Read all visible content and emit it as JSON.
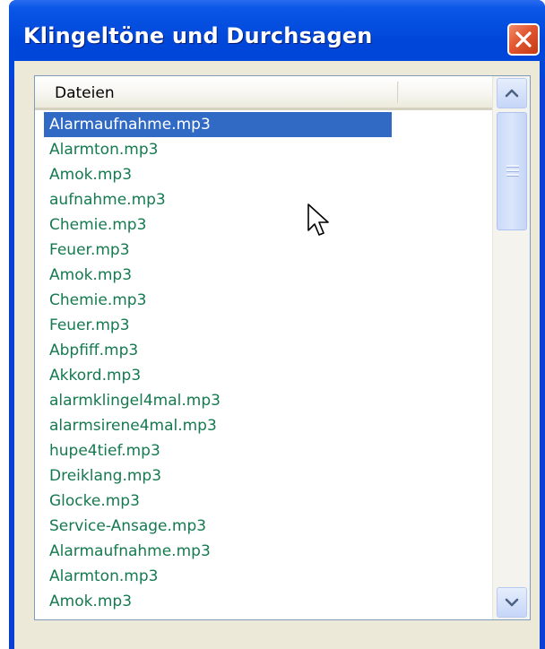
{
  "window": {
    "title": "Klingeltöne und Durchsagen"
  },
  "list": {
    "column_header": "Dateien",
    "selected_index": 0,
    "items": [
      "Alarmaufnahme.mp3",
      "Alarmton.mp3",
      "Amok.mp3",
      "aufnahme.mp3",
      "Chemie.mp3",
      "Feuer.mp3",
      "Amok.mp3",
      "Chemie.mp3",
      "Feuer.mp3",
      "Abpfiff.mp3",
      "Akkord.mp3",
      "alarmklingel4mal.mp3",
      "alarmsirene4mal.mp3",
      "hupe4tief.mp3",
      "Dreiklang.mp3",
      "Glocke.mp3",
      "Service-Ansage.mp3",
      "Alarmaufnahme.mp3",
      "Alarmton.mp3",
      "Amok.mp3"
    ]
  },
  "colors": {
    "title_bar": "#0047d9",
    "item_text": "#157a4f",
    "selection": "#316ac5",
    "close_button": "#e2552f"
  },
  "icons": {
    "close": "close-icon",
    "scroll_up": "chevron-up-icon",
    "scroll_down": "chevron-down-icon",
    "cursor": "mouse-pointer-icon"
  }
}
